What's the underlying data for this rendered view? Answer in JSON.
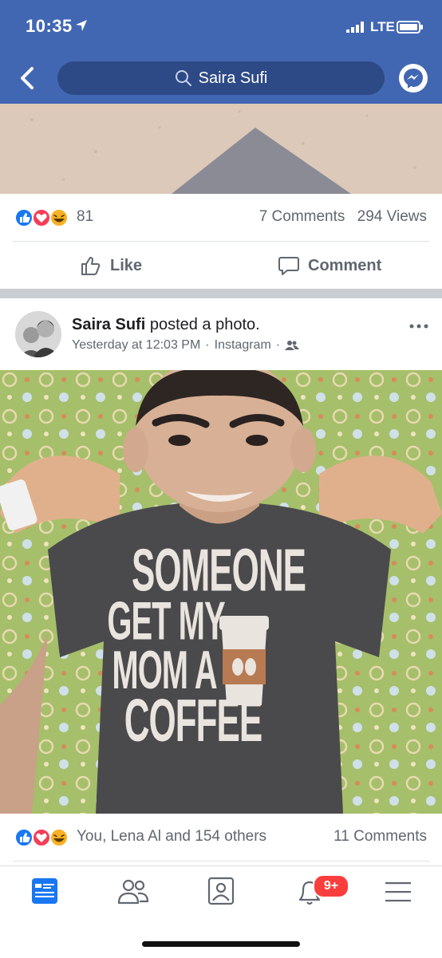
{
  "status_bar": {
    "time": "10:35",
    "network": "LTE"
  },
  "nav": {
    "search_text": "Saira Sufi"
  },
  "post1": {
    "reaction_count": "81",
    "comments": "7 Comments",
    "views": "294 Views",
    "like_label": "Like",
    "comment_label": "Comment"
  },
  "post2": {
    "author": "Saira Sufi",
    "action": "posted a photo.",
    "timestamp": "Yesterday at 12:03 PM",
    "source": "Instagram",
    "dot": "·",
    "shirt_text": [
      "SOMEONE",
      "GET MY",
      "MOM A",
      "COFFEE"
    ],
    "reactions_text": "You, Lena Al and 154 others",
    "comments": "11 Comments"
  },
  "tab_bar": {
    "notification_badge": "9+"
  },
  "colors": {
    "brand": "#4267b2",
    "brand_dark": "#2d4a86",
    "badge": "#fa3e3e",
    "like_blue": "#1877f2",
    "love_red": "#f33e58",
    "haha_yellow": "#f7b125"
  },
  "icons": [
    "back-arrow-icon",
    "search-icon",
    "messenger-icon",
    "like-thumb-icon",
    "comment-bubble-icon",
    "friends-audience-icon",
    "more-dots-icon",
    "news-feed-icon",
    "friends-icon",
    "profile-icon",
    "bell-icon",
    "menu-icon"
  ]
}
